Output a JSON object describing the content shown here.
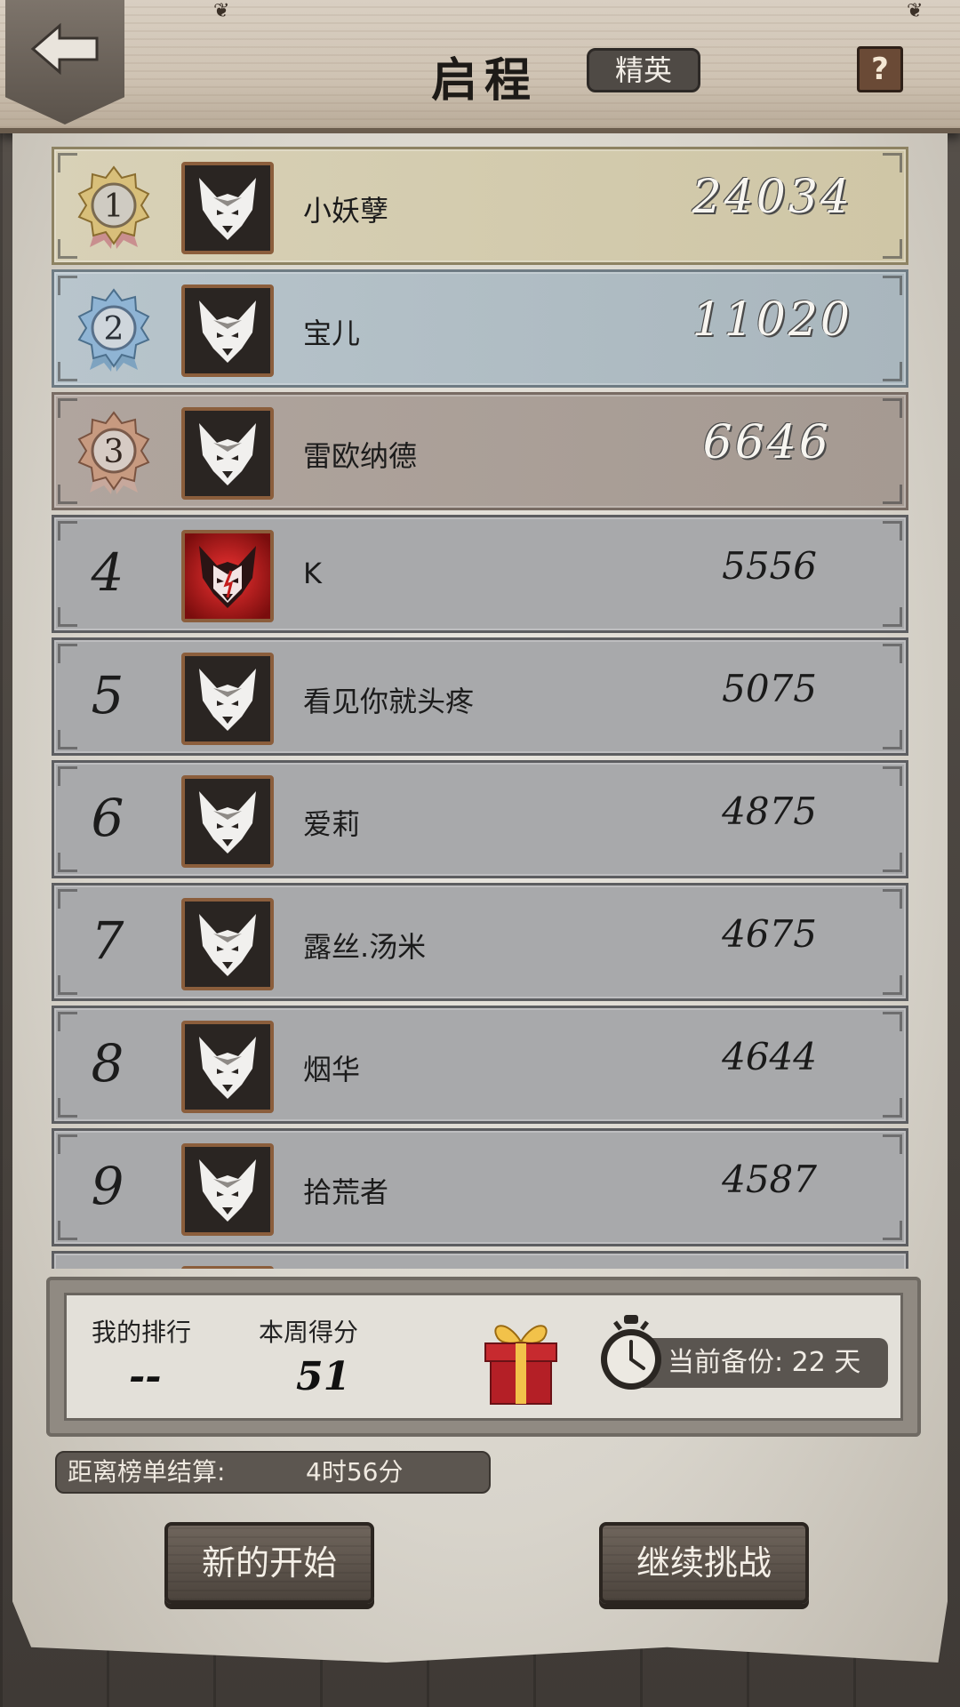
{
  "header": {
    "title": "启程",
    "mode": "精英",
    "help_label": "?"
  },
  "leaderboard": [
    {
      "rank": "1",
      "name": "小妖孽",
      "score": "24034",
      "tier": "gold"
    },
    {
      "rank": "2",
      "name": "宝儿",
      "score": "11020",
      "tier": "silver"
    },
    {
      "rank": "3",
      "name": "雷欧纳德",
      "score": "6646",
      "tier": "bronze"
    },
    {
      "rank": "4",
      "name": "K",
      "score": "5556",
      "tier": "normal",
      "avatar": "red-wolf-icon"
    },
    {
      "rank": "5",
      "name": "看见你就头疼",
      "score": "5075",
      "tier": "normal"
    },
    {
      "rank": "6",
      "name": "爱莉",
      "score": "4875",
      "tier": "normal"
    },
    {
      "rank": "7",
      "name": "露丝.汤米",
      "score": "4675",
      "tier": "normal"
    },
    {
      "rank": "8",
      "name": "烟华",
      "score": "4644",
      "tier": "normal"
    },
    {
      "rank": "9",
      "name": "拾荒者",
      "score": "4587",
      "tier": "normal"
    }
  ],
  "my_stats": {
    "rank_label": "我的排行",
    "rank_value": "--",
    "score_label": "本周得分",
    "score_value": "51",
    "backup_text": "当前备份: 22 天"
  },
  "settlement": {
    "label": "距离榜单结算:",
    "value": "4时56分"
  },
  "buttons": {
    "new_start": "新的开始",
    "continue": "继续挑战"
  },
  "colors": {
    "gold_row": "#d8d1b7",
    "silver_row": "#b8c5cc",
    "bronze_row": "#b0a59e",
    "normal_row": "#a8a9ab",
    "wood_button": "#5c534a"
  }
}
